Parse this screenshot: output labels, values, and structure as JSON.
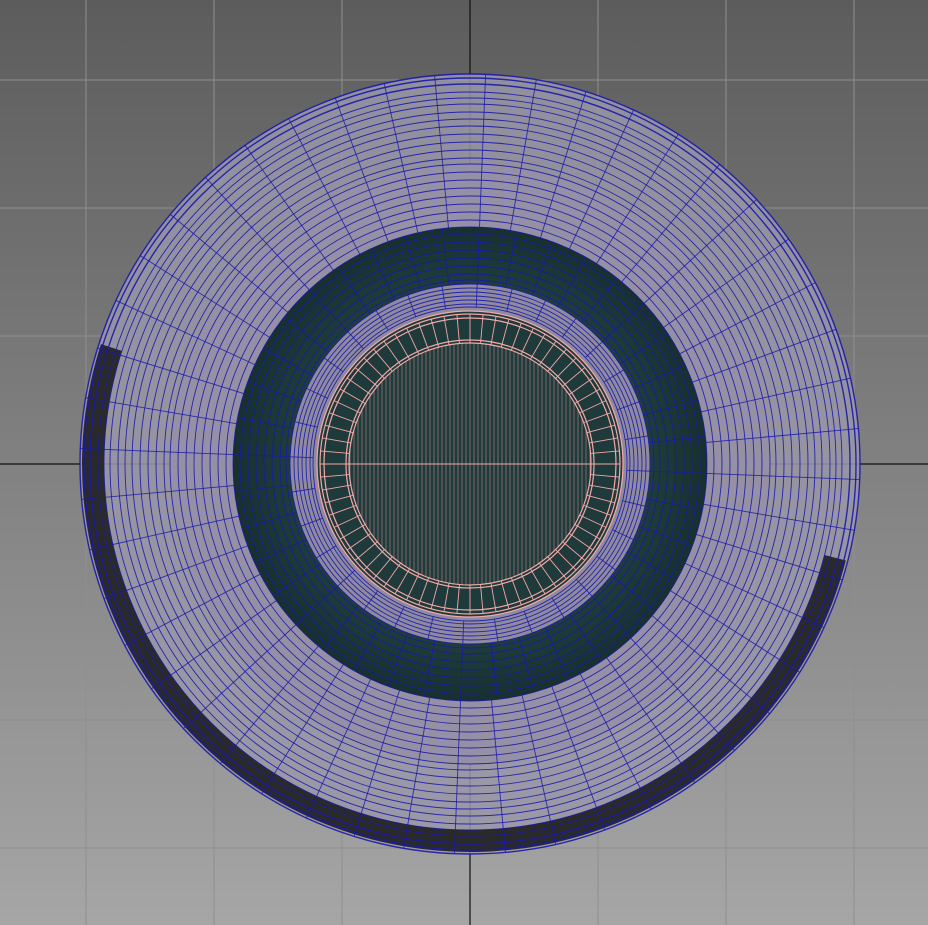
{
  "viewport": {
    "background_top": "#5c5c5c",
    "background_bottom": "#a6a6a6",
    "grid_color": "#8f8f8f",
    "axis_color": "#111111",
    "grid_visible": true
  },
  "mesh": {
    "wire_color": "#1a1aa8",
    "selected_wire_color": "#f2a8a8",
    "shaded_surface_color": "#1f3a3a",
    "dark_band_color": "#2a2a2a",
    "highlight_surface_color": "#9a96a8"
  }
}
